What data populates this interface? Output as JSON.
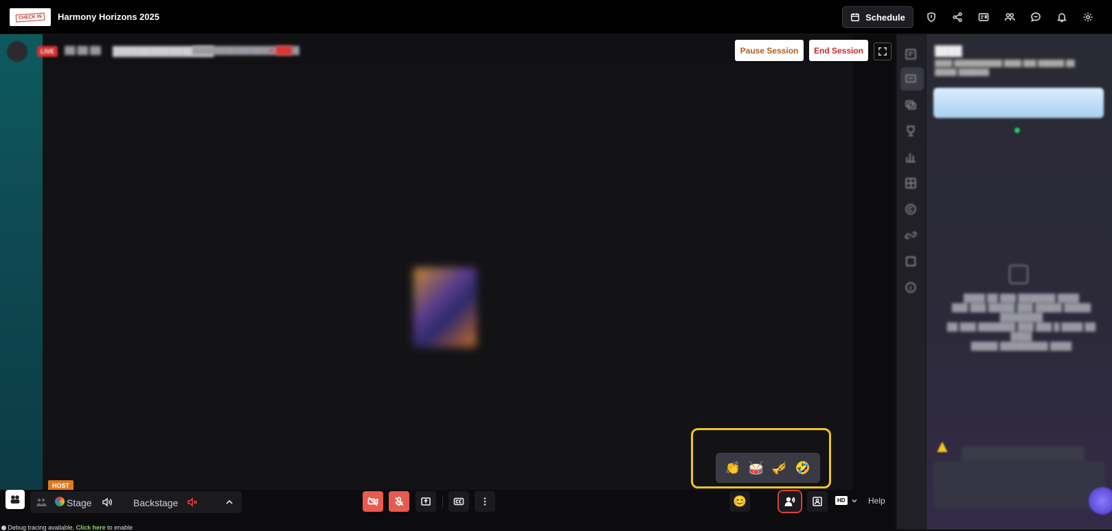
{
  "header": {
    "logo_text": "CHECK IN",
    "event_title": "Harmony Horizons 2025",
    "schedule_label": "Schedule",
    "icons": [
      "shield-icon",
      "share-icon",
      "id-card-icon",
      "people-icon",
      "chat-icon",
      "bell-icon",
      "gear-icon"
    ]
  },
  "stage": {
    "live_label": "LIVE",
    "pause_label": "Pause Session",
    "end_label": "End Session",
    "host_badge": "HOST"
  },
  "reactions": [
    "👏",
    "🥁",
    "🎺",
    "🤣"
  ],
  "bottom": {
    "stage_label": "Stage",
    "backstage_label": "Backstage",
    "hd_label": "HD",
    "help_label": "Help",
    "debug_text": "Debug tracing available.",
    "debug_link": "Click here",
    "debug_suffix": "to enable"
  },
  "colors": {
    "accent_red": "#e85a50",
    "highlight_yellow": "#f5c518",
    "host_orange": "#e07a1f",
    "pause_text": "#b05a1a",
    "end_text": "#c62828"
  }
}
